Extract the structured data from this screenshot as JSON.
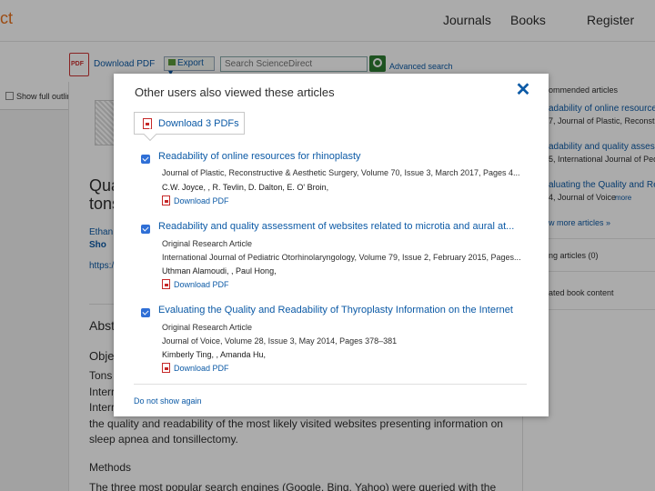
{
  "header": {
    "logo_text": "ct",
    "nav": [
      "Journals",
      "Books",
      "Register"
    ]
  },
  "toolbar": {
    "download_pdf": "Download PDF",
    "export": "Export",
    "search_placeholder": "Search ScienceDirect",
    "advanced_search": "Advanced search",
    "show_full_outline": "Show full outline"
  },
  "article": {
    "title_line1": "Qua",
    "title_line2": "tons",
    "author": "Ethan",
    "show": "Sho",
    "doi": "https:/",
    "abstract_heading": "Abst",
    "objective_heading": "Obje",
    "para_line1": "Tons",
    "para_line2": "Interr",
    "para_line3": "Interr",
    "para_line4": "the quality and readability of the most likely visited websites presenting information on",
    "para_line5": "sleep apnea and tonsillectomy.",
    "methods_heading": "Methods",
    "methods_text": "The three most popular search engines (Google, Bing, Yahoo) were queried with the"
  },
  "right_column": {
    "recommended": "ommended articles",
    "rec1_title": "adability of online resources",
    "rec1_source": "7, Journal of Plastic, Reconstructive",
    "rec2_title": "adability and quality assess",
    "rec2_source": "5, International Journal of Pediatric",
    "rec3_title": "aluating the Quality and Rea",
    "rec3_source": "4, Journal of Voice",
    "rec3_more": "more",
    "view_more": "w more articles »",
    "citing": "ng articles (0)",
    "related_book": "ated book content"
  },
  "modal": {
    "title": "Other users also viewed these articles",
    "close": "✕",
    "download_all": "Download 3 PDFs",
    "items": [
      {
        "title": "Readability of online resources for rhinoplasty",
        "type": "",
        "source": "Journal of Plastic, Reconstructive & Aesthetic Surgery, Volume 70, Issue 3, March 2017, Pages 4...",
        "authors": "C.W. Joyce, , R. Tevlin, D. Dalton, E. O' Broin,",
        "pdf_label": "Download PDF",
        "checked": true
      },
      {
        "title": "Readability and quality assessment of websites related to microtia and aural at...",
        "type": "Original Research Article",
        "source": "International Journal of Pediatric Otorhinolaryngology, Volume 79, Issue 2, February 2015, Pages...",
        "authors": "Uthman Alamoudi, , Paul Hong,",
        "pdf_label": "Download PDF",
        "checked": true
      },
      {
        "title": "Evaluating the Quality and Readability of Thyroplasty Information on the Internet",
        "type": "Original Research Article",
        "source": "Journal of Voice, Volume 28, Issue 3, May 2014, Pages 378–381",
        "authors": "Kimberly Ting, , Amanda Hu,",
        "pdf_label": "Download PDF",
        "checked": true
      }
    ],
    "dont_show": "Do not show again"
  },
  "colors": {
    "link": "#0c5aa6",
    "accent_orange": "#e9711c",
    "checkbox": "#2f6fd6",
    "pdf_red": "#c62828"
  }
}
